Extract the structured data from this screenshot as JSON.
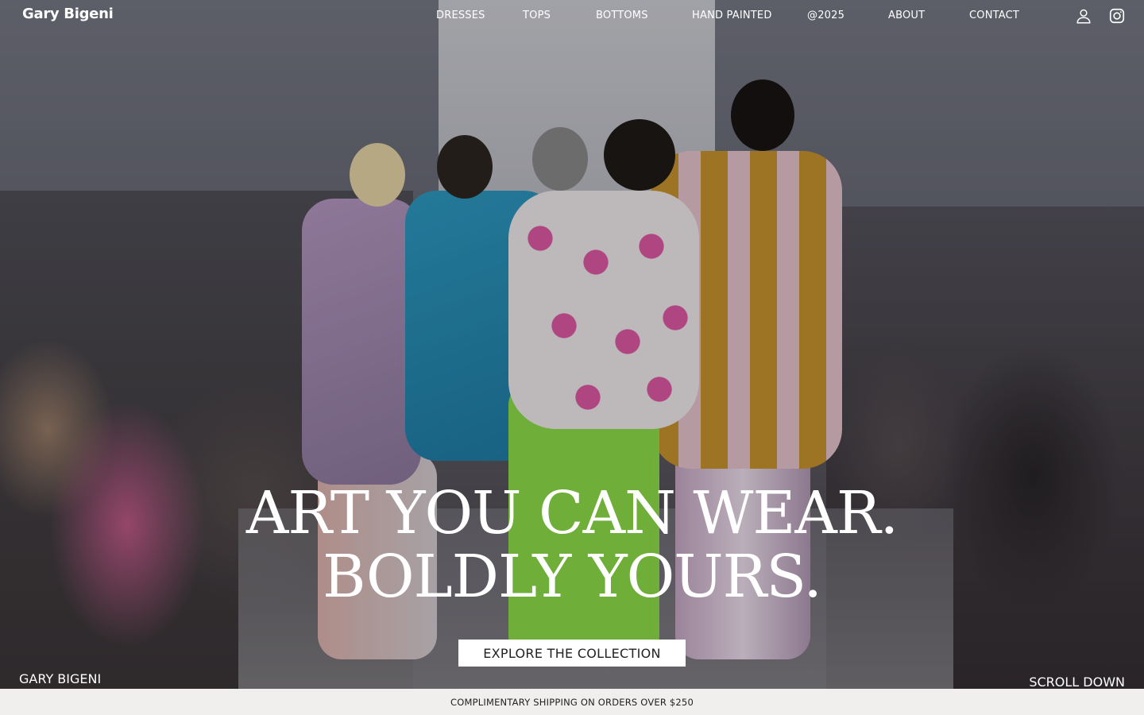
{
  "brand": {
    "logo": "Gary Bigeni"
  },
  "nav": {
    "items": [
      {
        "label": "DRESSES"
      },
      {
        "label": "TOPS"
      },
      {
        "label": "BOTTOMS"
      },
      {
        "label": "HAND PAINTED"
      },
      {
        "label": "@2025"
      },
      {
        "label": "ABOUT"
      },
      {
        "label": "CONTACT"
      }
    ],
    "icons": [
      "user-account-icon",
      "instagram-icon"
    ]
  },
  "hero": {
    "headline_line1": "ART YOU CAN WEAR.",
    "headline_line2": "BOLDLY YOURS.",
    "cta_label": "EXPLORE THE COLLECTION",
    "footer_brand": "GARY BIGENI",
    "scroll_label": "SCROLL DOWN"
  },
  "announcement": {
    "text": "COMPLIMENTARY SHIPPING ON ORDERS OVER $250"
  },
  "colors": {
    "text_on_hero": "#ffffff",
    "cta_bg": "#ffffff",
    "announcement_bg": "#f1efed"
  }
}
